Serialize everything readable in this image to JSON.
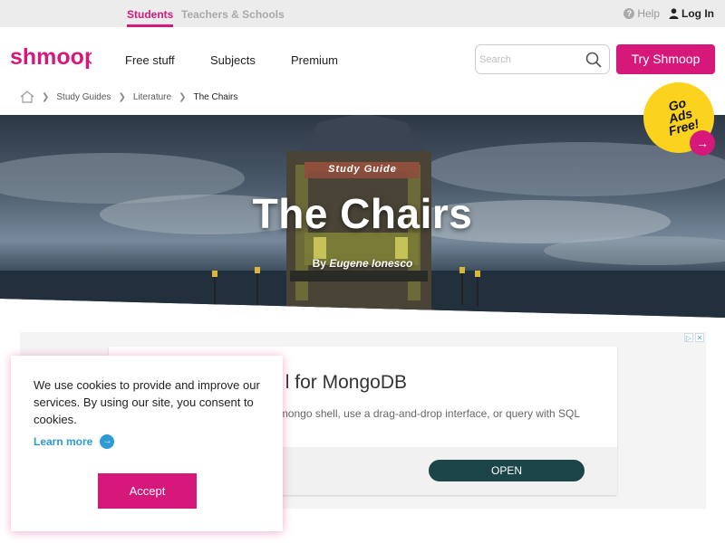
{
  "topbar": {
    "tabs": [
      "Students",
      "Teachers & Schools"
    ],
    "help_label": "Help",
    "login_label": "Log In"
  },
  "brand": {
    "logo_text": "shmoop",
    "accent": "#d6187a"
  },
  "nav": {
    "links": [
      "Free stuff",
      "Subjects",
      "Premium"
    ],
    "search_placeholder": "Search",
    "try_label": "Try Shmoop"
  },
  "breadcrumb": [
    "Study Guides",
    "Literature",
    "The Chairs"
  ],
  "hero": {
    "label": "Study Guide",
    "title": "The Chairs",
    "byline_prefix": "By",
    "author": "Eugene Ionesco"
  },
  "badge": {
    "line1": "Go",
    "line2": "Ads Free!"
  },
  "ad": {
    "headline": "l for MongoDB",
    "body": "mongo shell, use a drag-and-drop interface, or query with SQL",
    "cta": "OPEN",
    "mark_info": "▷",
    "mark_close": "✕"
  },
  "cookie": {
    "text": "We use cookies to provide and improve our services. By using our site, you consent to cookies.",
    "learn_more": "Learn more",
    "accept": "Accept"
  },
  "icons": {
    "help": "question-circle-icon",
    "login": "user-icon",
    "search": "search-icon",
    "home": "home-icon",
    "chevron": "chevron-right-icon",
    "arrow": "arrow-right-icon"
  }
}
